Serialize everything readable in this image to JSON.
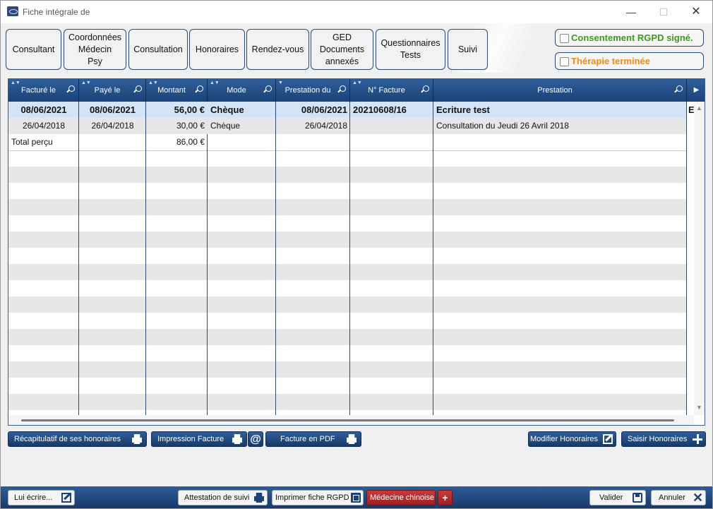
{
  "window": {
    "title": "Fiche intégrale de",
    "min": "—",
    "max": "☐",
    "close": "✕"
  },
  "tabs": [
    {
      "label": "Consultant"
    },
    {
      "label": "Coordonnées\nMédecin\nPsy"
    },
    {
      "label": "Consultation"
    },
    {
      "label": "Honoraires"
    },
    {
      "label": "Rendez-vous"
    },
    {
      "label": "GED\nDocuments\nannexés"
    },
    {
      "label": "Questionnaires\nTests"
    },
    {
      "label": "Suivi"
    }
  ],
  "checks": {
    "rgpd": {
      "label": "Consentement RGPD signé.",
      "color": "#3c9a1a"
    },
    "therapie": {
      "label": "Thérapie terminée",
      "color": "#f08a1c"
    }
  },
  "table": {
    "headers": [
      "Facturé le",
      "Payé le",
      "Montant",
      "Mode",
      "Prestation du",
      "N° Facture",
      "Prestation"
    ],
    "rows": [
      {
        "facture": "08/06/2021",
        "paye": "08/06/2021",
        "montant": "56,00 €",
        "mode": "Chèque",
        "prestation_du": "08/06/2021",
        "numero": "20210608/16",
        "prestation": "Ecriture test",
        "extra": "E"
      },
      {
        "facture": "26/04/2018",
        "paye": "26/04/2018",
        "montant": "30,00 €",
        "mode": "Chèque",
        "prestation_du": "26/04/2018",
        "numero": "",
        "prestation": "Consultation du Jeudi 26 Avril 2018",
        "extra": ""
      }
    ],
    "total_label": "Total perçu",
    "total_value": "86,00 €"
  },
  "actions": {
    "recap": "Récapitulatif de ses honoraires",
    "impression": "Impression Facture",
    "at": "@",
    "pdf": "Facture en PDF",
    "modifier": "Modifier Honoraires",
    "saisir": "Saisir Honoraires"
  },
  "bottom": {
    "ecrire": "Lui écrire...",
    "attestation": "Attestation de suivi",
    "imprimer_rgpd": "Imprimer fiche RGPD",
    "medecine": "Médecine chinoise",
    "plus": "+",
    "valider": "Valider",
    "annuler": "Annuler"
  }
}
